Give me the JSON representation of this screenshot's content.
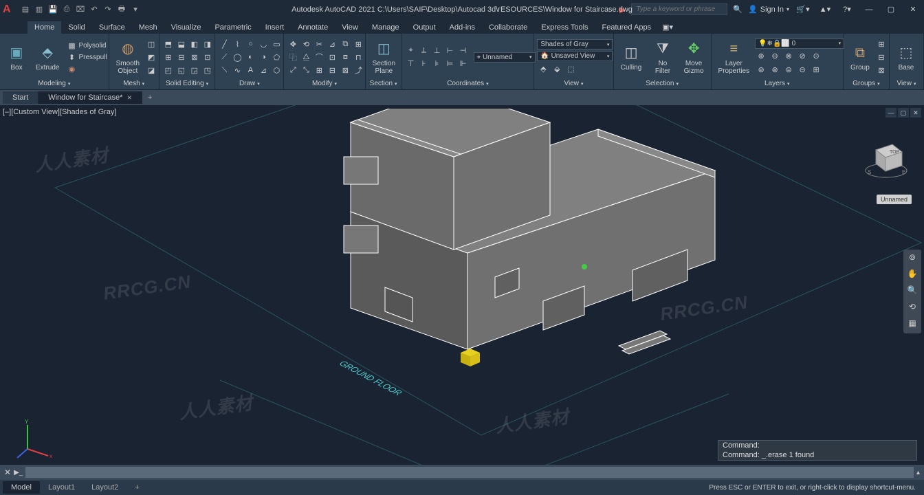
{
  "app": {
    "title": "Autodesk AutoCAD 2021   C:\\Users\\SAIF\\Desktop\\Autocad 3d\\rESOURCES\\Window for Staircase.dwg"
  },
  "search": {
    "placeholder": "Type a keyword or phrase"
  },
  "signin": {
    "label": "Sign In"
  },
  "menutabs": [
    "Home",
    "Solid",
    "Surface",
    "Mesh",
    "Visualize",
    "Parametric",
    "Insert",
    "Annotate",
    "View",
    "Manage",
    "Output",
    "Add-ins",
    "Collaborate",
    "Express Tools",
    "Featured Apps"
  ],
  "active_menutab": 0,
  "panels": {
    "modeling": {
      "title": "Modeling",
      "box": "Box",
      "extrude": "Extrude",
      "polysolid": "Polysolid",
      "presspull": "Presspull"
    },
    "mesh": {
      "title": "Mesh",
      "smooth": "Smooth\nObject"
    },
    "solidedit": {
      "title": "Solid Editing"
    },
    "draw": {
      "title": "Draw"
    },
    "modify": {
      "title": "Modify"
    },
    "section": {
      "title": "Section",
      "plane": "Section\nPlane"
    },
    "coords": {
      "title": "Coordinates",
      "unnamed": "Unnamed"
    },
    "view": {
      "title": "View",
      "shades": "Shades of Gray",
      "unsaved": "Unsaved View"
    },
    "selection": {
      "title": "Selection",
      "culling": "Culling",
      "nofilter": "No Filter",
      "move": "Move\nGizmo"
    },
    "layers": {
      "title": "Layers",
      "props": "Layer\nProperties",
      "layer0": "0"
    },
    "groups": {
      "title": "Groups",
      "group": "Group"
    },
    "viewp": {
      "title": "View",
      "base": "Base"
    }
  },
  "filetabs": {
    "start": "Start",
    "file": "Window for Staircase*"
  },
  "viewport": {
    "label": "[–][Custom View][Shades of Gray]",
    "unnamed": "Unnamed"
  },
  "viewcube": {
    "top": "TOP"
  },
  "floor_label": "GROUND FLOOR",
  "command": {
    "l1": "Command:",
    "l2": "Command: _.erase 1 found"
  },
  "status": {
    "model": "Model",
    "layout1": "Layout1",
    "layout2": "Layout2",
    "hint": "Press ESC or ENTER to exit, or right-click to display shortcut-menu."
  },
  "watermark": "RRCG.CN",
  "watermark2": "人人素材"
}
